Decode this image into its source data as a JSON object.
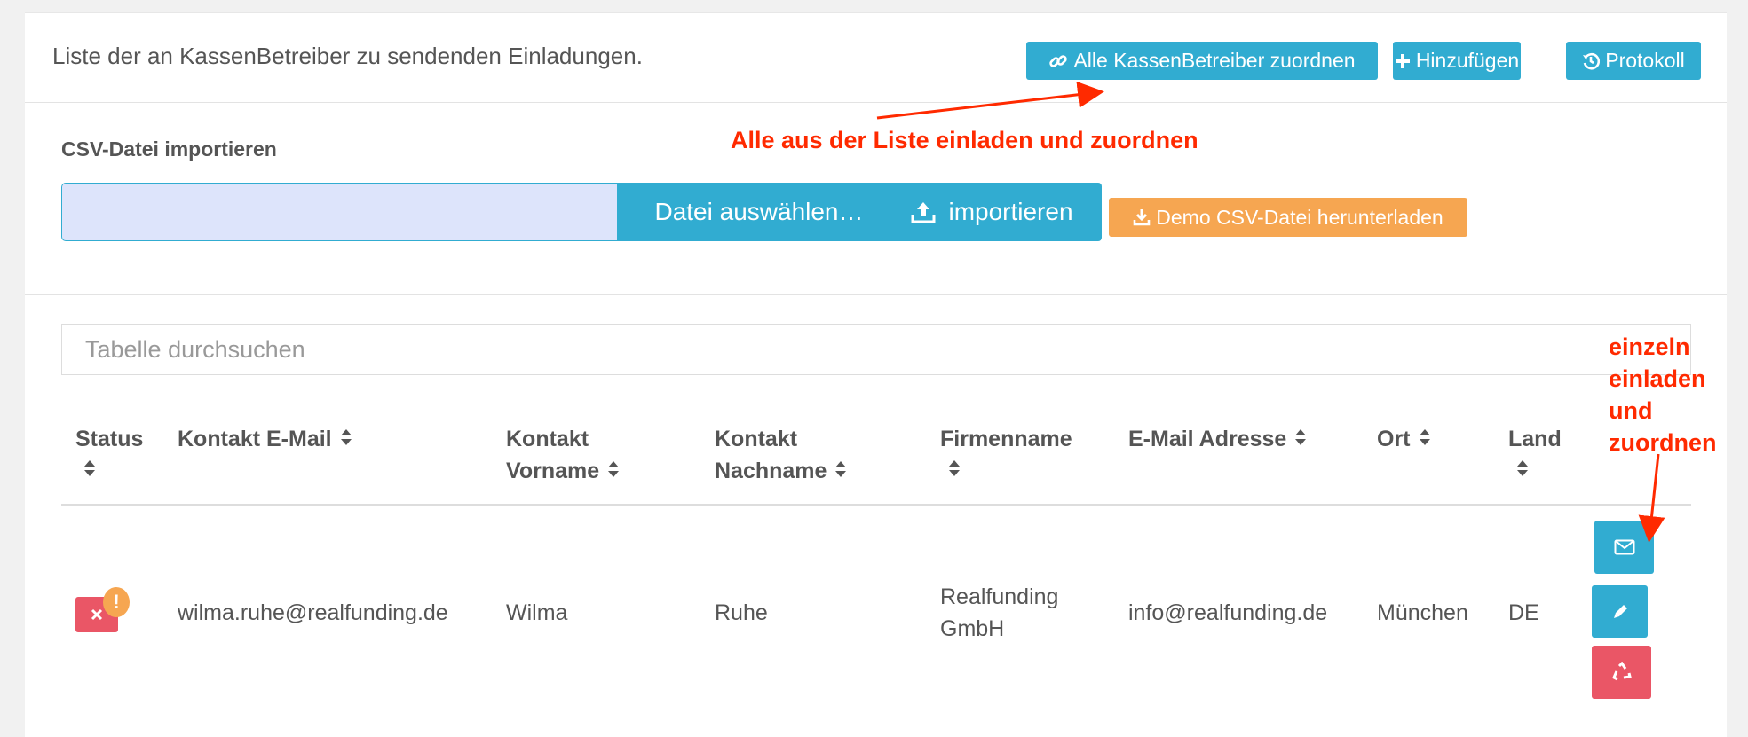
{
  "header": {
    "title": "Liste der an KassenBetreiber zu sendenden Einladungen.",
    "assign_all_label": "Alle KassenBetreiber zuordnen",
    "add_label": "Hinzufügen",
    "protocol_label": "Protokoll"
  },
  "annotations": {
    "assign_all_note": "Alle aus der Liste einladen und zuordnen",
    "single_note_lines": [
      "einzeln",
      "einladen",
      "und",
      "zuordnen"
    ]
  },
  "import": {
    "label": "CSV-Datei importieren",
    "choose_file_label": "Datei auswählen…",
    "import_label": "importieren",
    "demo_label": "Demo CSV-Datei herunterladen"
  },
  "search": {
    "placeholder": "Tabelle durchsuchen"
  },
  "table": {
    "columns": {
      "status": "Status",
      "contact_email": "Kontakt E-Mail",
      "contact_first_line1": "Kontakt",
      "contact_first_line2": "Vorname",
      "contact_last_line1": "Kontakt",
      "contact_last_line2": "Nachname",
      "company": "Firmenname",
      "email": "E-Mail Adresse",
      "city": "Ort",
      "country": "Land"
    },
    "rows": [
      {
        "status_warning": "!",
        "contact_email": "wilma.ruhe@realfunding.de",
        "first_name": "Wilma",
        "last_name": "Ruhe",
        "company_line1": "Realfunding",
        "company_line2": "GmbH",
        "email": "info@realfunding.de",
        "city": "München",
        "country": "DE"
      }
    ]
  },
  "colors": {
    "primary": "#31acd1",
    "warning": "#f6a651",
    "danger": "#ea5666",
    "annotation": "#ff2a00"
  }
}
